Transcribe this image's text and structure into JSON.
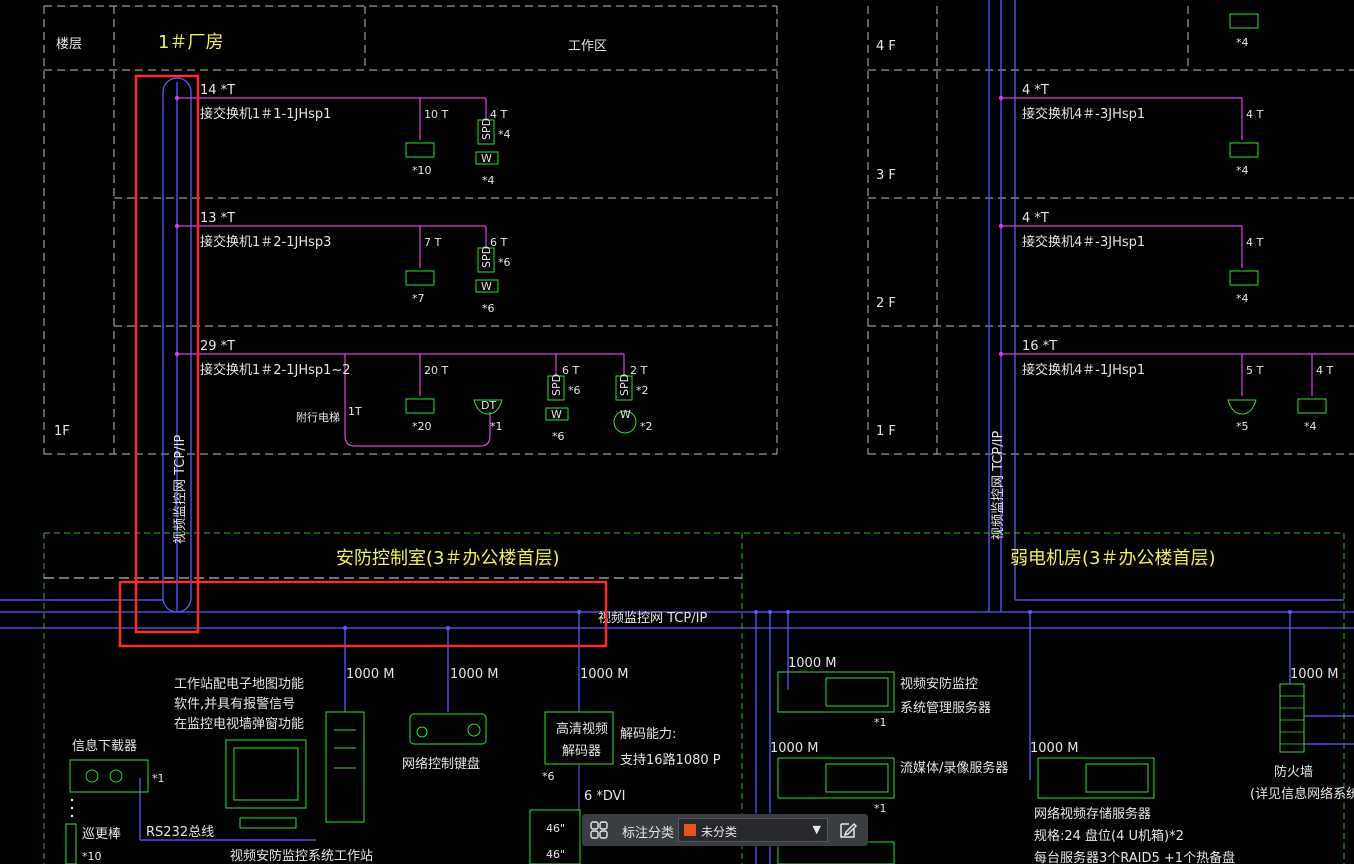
{
  "colors": {
    "background": "#000000",
    "grid": "#bcbcbc",
    "network": "#5a5aff",
    "cable": "#e040e0",
    "device": "#22e622",
    "highlight": "#ff2a2a",
    "zone": "#22c022",
    "title": "#f2f25a"
  },
  "header": {
    "floor_col": "楼层",
    "building": "1＃厂房",
    "work_area": "工作区"
  },
  "floors_right": [
    "4 F",
    "3 F",
    "2 F",
    "1 F"
  ],
  "floor_left_1f": "1F",
  "backbone_label": "视频监控网 TCP/IP",
  "switches_left": [
    {
      "count": "14 *T",
      "name": "接交换机1＃1-1JHsp1",
      "ports_a": "10 T",
      "ports_b": "4 T",
      "spd": "SPD",
      "spd_mult": "*4",
      "w": "W",
      "qty_a": "*10",
      "qty_b": "*4"
    },
    {
      "count": "13 *T",
      "name": "接交换机1＃2-1JHsp3",
      "ports_a": "7 T",
      "ports_b": "6 T",
      "spd": "SPD",
      "spd_mult": "*6",
      "w": "W",
      "qty_a": "*7",
      "qty_b": "*6"
    },
    {
      "count": "29 *T",
      "name": "接交换机1＃2-1JHsp1~2",
      "ports_a": "20 T",
      "ports_b": "6 T",
      "ports_c": "2 T",
      "spd": "SPD",
      "spd_mult_b": "*6",
      "spd_mult_c": "*2",
      "w": "W",
      "qty_a": "*20",
      "qty_dt": "*1",
      "dt": "DT",
      "qty_b": "*6",
      "qty_c": "*2",
      "elevator": "附行电梯",
      "elevator_t": "1T"
    }
  ],
  "switches_right": [
    {
      "count": "4 *T",
      "name": "接交换机4＃-3JHsp1",
      "ports": "4 T",
      "qty": "*4"
    },
    {
      "count": "4 *T",
      "name": "接交换机4＃-3JHsp1",
      "ports": "4 T",
      "qty": "*4"
    },
    {
      "count": "16 *T",
      "name": "接交换机4＃-1JHsp1",
      "ports_a": "5 T",
      "ports_b": "4 T",
      "qty_a": "*5",
      "qty_b": "*4"
    }
  ],
  "top_right_qty": "*4",
  "zones": {
    "security_room": "安防控制室(3＃办公楼首层)",
    "weak_room": "弱电机房(3＃办公楼首层)"
  },
  "security_devices": {
    "workstation_note": [
      "工作站配电子地图功能",
      "软件,并具有报警信号",
      "在监控电视墙弹窗功能"
    ],
    "workstation_name": "视频安防监控系统工作站",
    "info_downloader": "信息下载器",
    "info_qty": "*1",
    "patrol_rod": "巡更棒",
    "patrol_qty": "*10",
    "rs232": "RS232总线",
    "link_1000": "1000 M",
    "keyboard": "网络控制键盘",
    "decoder_box": [
      "高清视频",
      "解码器"
    ],
    "decoder_qty": "*6",
    "decode_capacity": [
      "解码能力:",
      "支持16路1080 P"
    ],
    "dvi": "6 *DVI",
    "monitor_46": "46\""
  },
  "server_devices": [
    {
      "link": "1000 M",
      "label": [
        "视频安防监控",
        "系统管理服务器"
      ],
      "qty": "*1"
    },
    {
      "link": "1000 M",
      "label": [
        "流媒体/录像服务器"
      ],
      "qty": "*1"
    },
    {
      "link": "1000 M",
      "label": [
        "网络视频存储服务器",
        "规格:24 盘位(4 U机箱)*2",
        "每台服务器3个RAID5 +1个热备盘"
      ],
      "qty": ""
    }
  ],
  "firewall": {
    "link": "1000 M",
    "label": "防火墙",
    "note": "(详见信息网络系统图)"
  },
  "toolbar": {
    "label": "标注分类",
    "value": "未分类",
    "swatch": "#e8521c"
  }
}
